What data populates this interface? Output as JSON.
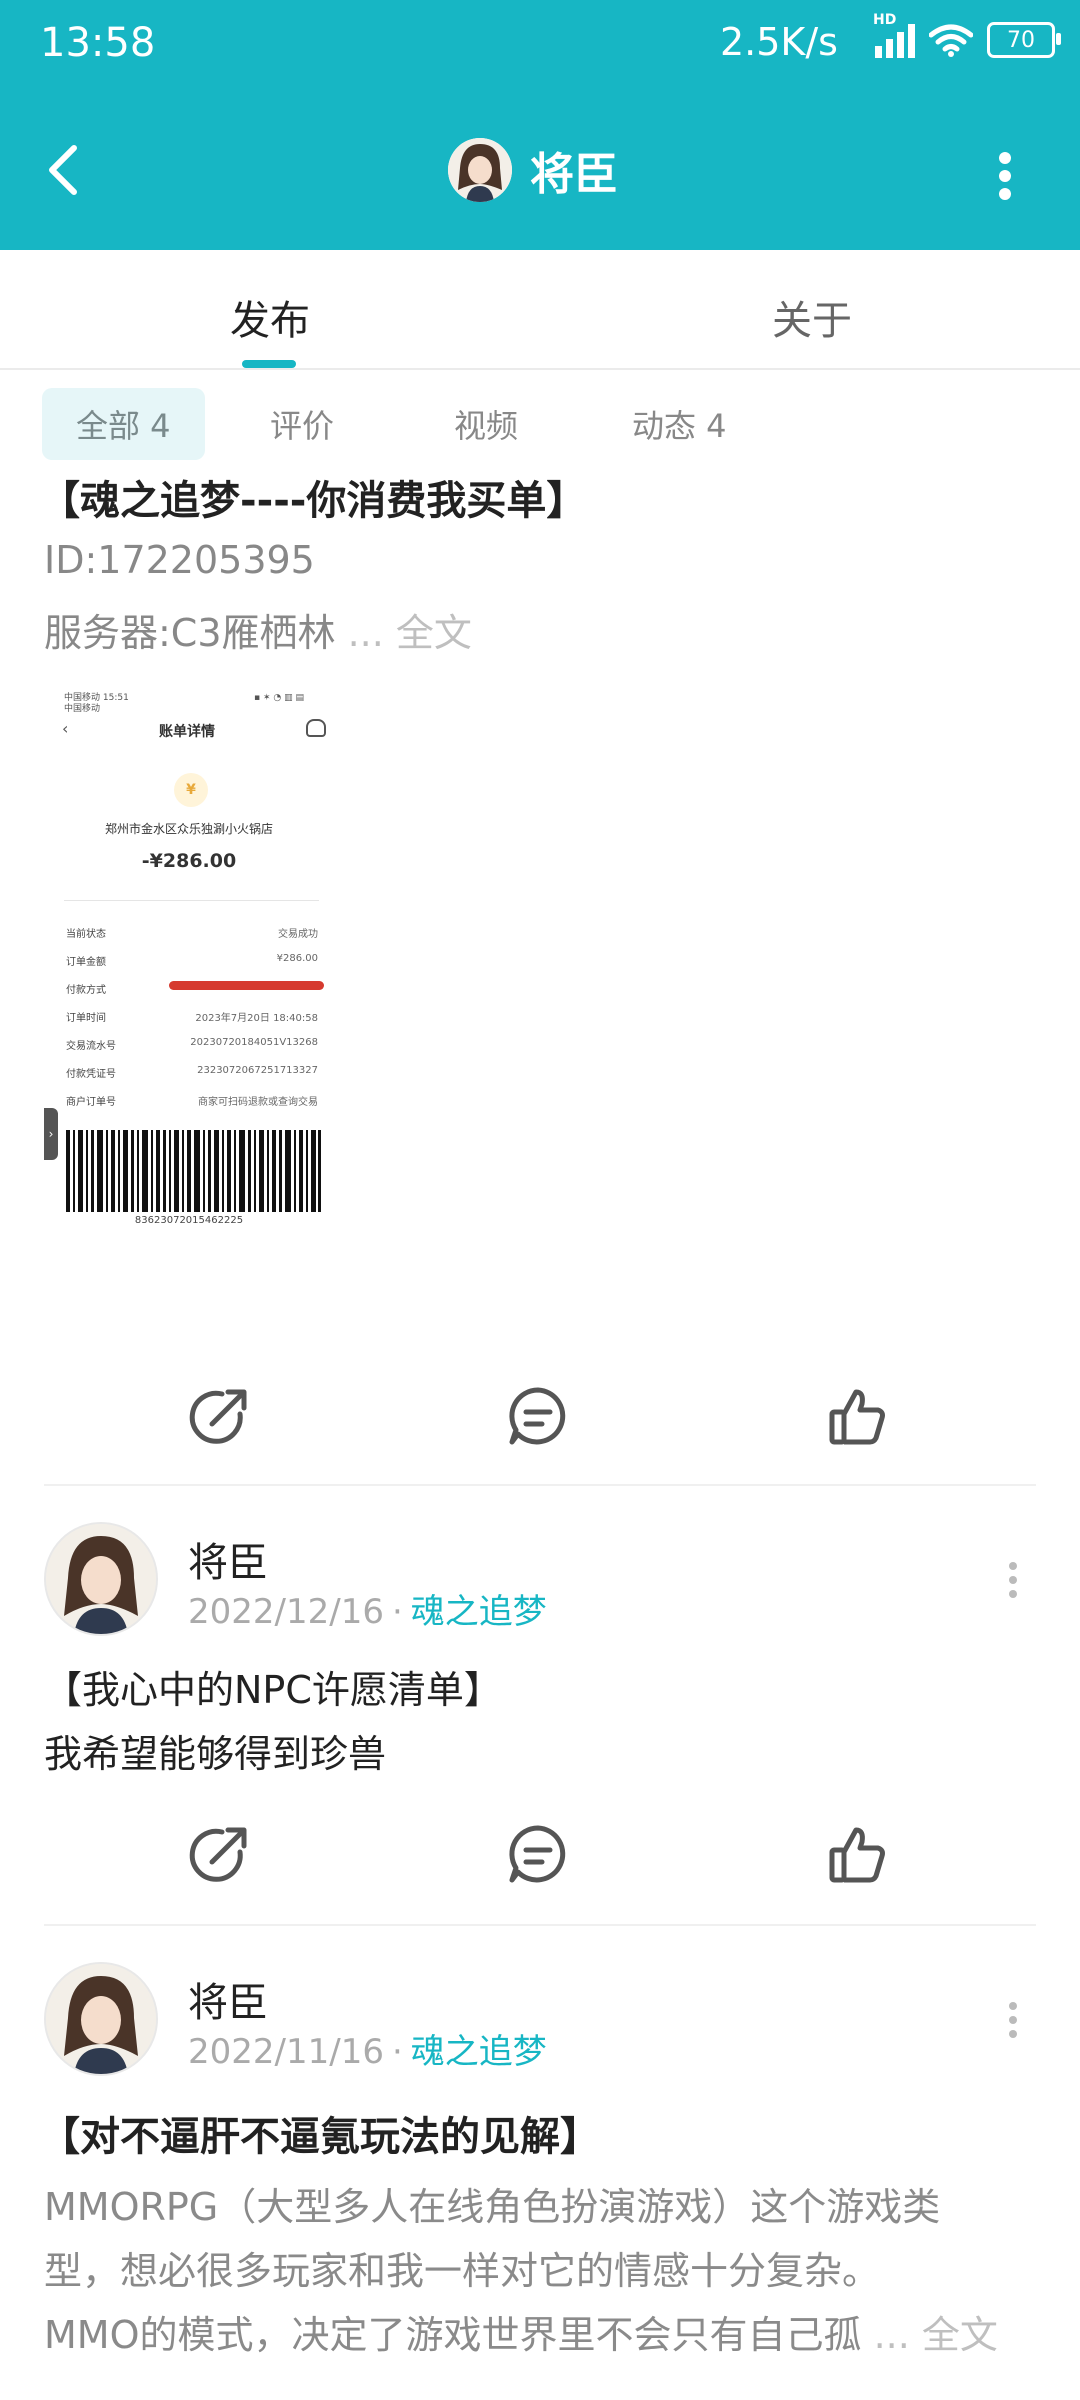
{
  "status_bar": {
    "time": "13:58",
    "speed": "2.5K/s",
    "signal_tag": "HD",
    "battery": "70"
  },
  "header": {
    "title": "将臣",
    "back_icon": "chevron-left-icon",
    "more_icon": "more-vertical-icon"
  },
  "tabs": [
    {
      "label": "发布"
    },
    {
      "label": "关于"
    }
  ],
  "filters": [
    {
      "label": "全部 4"
    },
    {
      "label": "评价"
    },
    {
      "label": "视频"
    },
    {
      "label": "动态 4"
    }
  ],
  "post1": {
    "title": "【魂之追梦----你消费我买单】",
    "line1": "ID:172205395",
    "line2": "服务器:C3雁栖林",
    "ellipsis": " ... ",
    "more": "全文",
    "receipt": {
      "status_left": "中国移动 15:51",
      "status_left2": "中国移动",
      "status_right": "▪ ✶ ◔ ▥ ▤",
      "title": "账单详情",
      "logo": "¥",
      "merchant": "郑州市金水区众乐独涮小火锅店",
      "amount": "-¥286.00",
      "rows": [
        {
          "label": "当前状态",
          "value": "交易成功"
        },
        {
          "label": "订单金额",
          "value": "¥286.00"
        },
        {
          "label": "付款方式",
          "value": ""
        },
        {
          "label": "订单时间",
          "value": "2023年7月20日 18:40:58"
        },
        {
          "label": "交易流水号",
          "value": "20230720184051V13268"
        },
        {
          "label": "付款凭证号",
          "value": "2323072067251713327"
        },
        {
          "label": "商户订单号",
          "value": "商家可扫码退款或查询交易"
        }
      ],
      "barcode_number": "83623072015462225"
    }
  },
  "post2": {
    "author": "将臣",
    "date": "2022/12/16",
    "sep": "·",
    "game": "魂之追梦",
    "title": "【我心中的NPC许愿清单】",
    "body": "我希望能够得到珍兽"
  },
  "post3": {
    "author": "将臣",
    "date": "2022/11/16",
    "sep": "·",
    "game": "魂之追梦",
    "title": "【对不逼肝不逼氪玩法的见解】",
    "lines": [
      "MMORPG（大型多人在线角色扮演游戏）这个游戏类",
      "型，想必很多玩家和我一样对它的情感十分复杂。",
      "MMO的模式，决定了游戏世界里不会只有自己孤"
    ],
    "ellipsis": " ... ",
    "more": "全文"
  },
  "actions": {
    "share_icon": "share-icon",
    "comment_icon": "comment-icon",
    "like_icon": "thumbs-up-icon"
  },
  "colors": {
    "accent": "#17b6c4",
    "redaction": "#d63a2f"
  }
}
